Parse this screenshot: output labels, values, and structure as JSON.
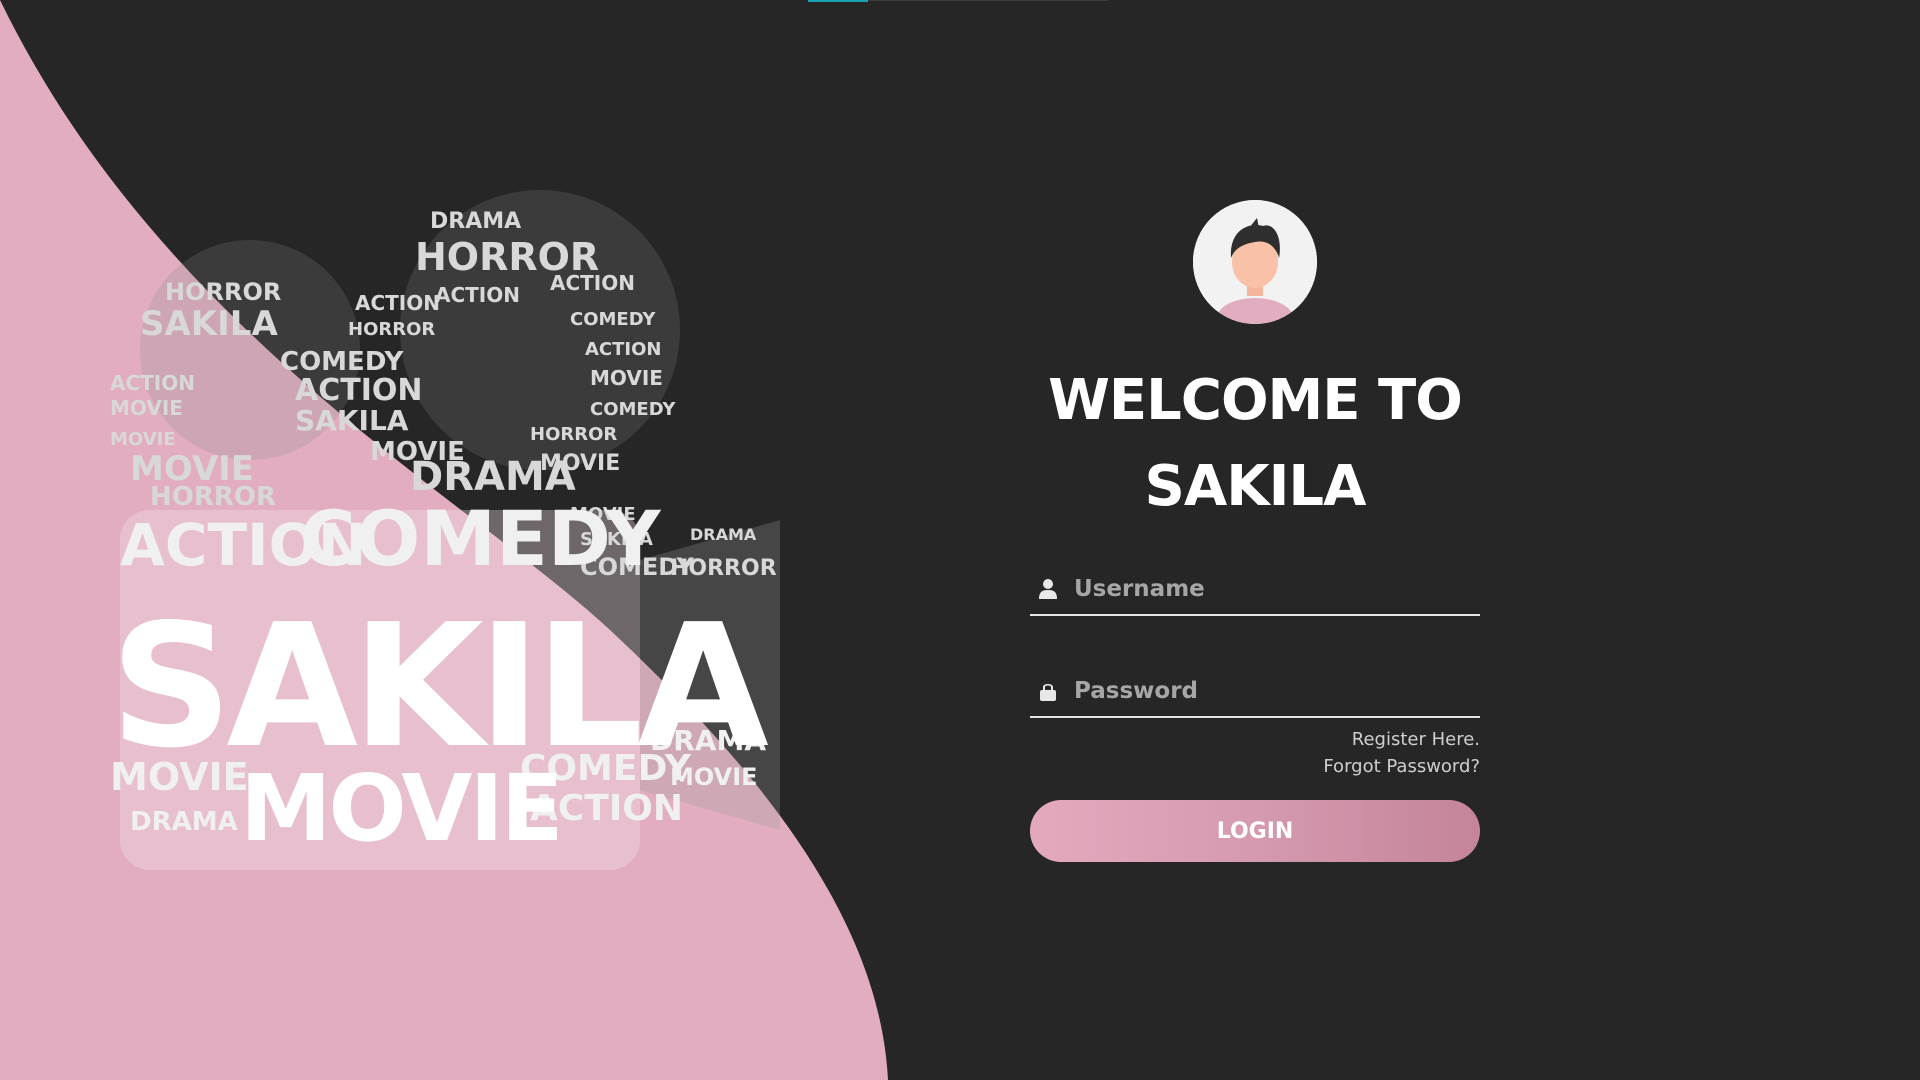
{
  "theme": {
    "background": "#262626",
    "accent_pink": "#e2adc0",
    "button_gradient_start": "#e3a9bd",
    "button_gradient_end": "#c48499",
    "top_accent": "#1aa3b0"
  },
  "logo": {
    "main_word": "SAKILA",
    "secondary_word": "MOVIE",
    "cloud_words": [
      "HORROR",
      "DRAMA",
      "COMEDY",
      "ACTION",
      "MOVIE",
      "SAKILA"
    ]
  },
  "login": {
    "avatar_icon": "user-avatar-icon",
    "title_line1": "WELCOME TO",
    "title_line2": "SAKILA",
    "username_placeholder": "Username",
    "username_icon": "user-icon",
    "password_placeholder": "Password",
    "password_icon": "lock-icon",
    "register_link": "Register Here.",
    "forgot_link": "Forgot Password?",
    "login_label": "LOGIN"
  }
}
